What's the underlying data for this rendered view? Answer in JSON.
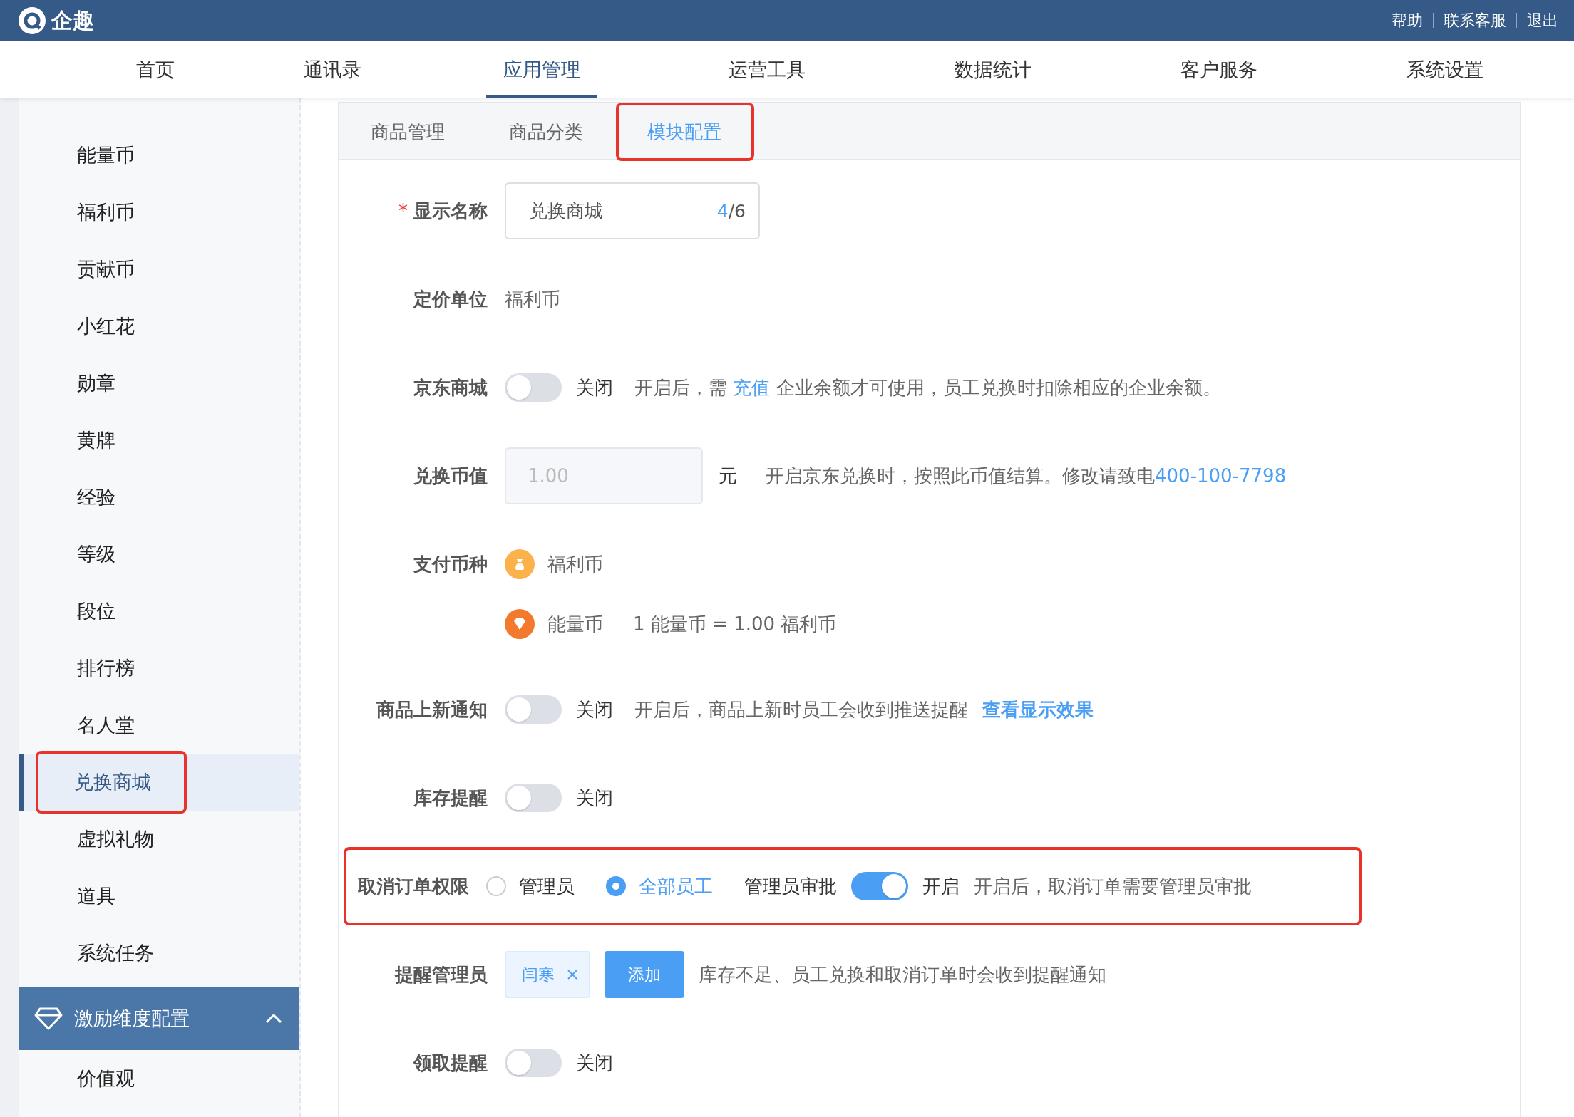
{
  "topbar": {
    "logo": "企趣",
    "links": [
      "帮助",
      "联系客服",
      "退出"
    ]
  },
  "nav": [
    {
      "label": "首页",
      "selected": false
    },
    {
      "label": "通讯录",
      "selected": false
    },
    {
      "label": "应用管理",
      "selected": true
    },
    {
      "label": "运营工具",
      "selected": false
    },
    {
      "label": "数据统计",
      "selected": false
    },
    {
      "label": "客户服务",
      "selected": false
    },
    {
      "label": "系统设置",
      "selected": false
    }
  ],
  "sidebar": {
    "items": [
      {
        "label": "能量币",
        "selected": false,
        "highlighted": false
      },
      {
        "label": "福利币",
        "selected": false,
        "highlighted": false
      },
      {
        "label": "贡献币",
        "selected": false,
        "highlighted": false
      },
      {
        "label": "小红花",
        "selected": false,
        "highlighted": false
      },
      {
        "label": "勋章",
        "selected": false,
        "highlighted": false
      },
      {
        "label": "黄牌",
        "selected": false,
        "highlighted": false
      },
      {
        "label": "经验",
        "selected": false,
        "highlighted": false
      },
      {
        "label": "等级",
        "selected": false,
        "highlighted": false
      },
      {
        "label": "段位",
        "selected": false,
        "highlighted": false
      },
      {
        "label": "排行榜",
        "selected": false,
        "highlighted": false
      },
      {
        "label": "名人堂",
        "selected": false,
        "highlighted": false
      },
      {
        "label": "兑换商城",
        "selected": true,
        "highlighted": true
      },
      {
        "label": "虚拟礼物",
        "selected": false,
        "highlighted": false
      },
      {
        "label": "道具",
        "selected": false,
        "highlighted": false
      },
      {
        "label": "系统任务",
        "selected": false,
        "highlighted": false
      }
    ],
    "section": {
      "label": "激励维度配置",
      "expanded": true,
      "items": [
        "价值观"
      ]
    }
  },
  "tabs": [
    {
      "label": "商品管理",
      "selected": false,
      "highlighted": false
    },
    {
      "label": "商品分类",
      "selected": false,
      "highlighted": false
    },
    {
      "label": "模块配置",
      "selected": true,
      "highlighted": true
    }
  ],
  "form": [
    {
      "kind": "input",
      "label": "显示名称",
      "required_mark": "*",
      "value": "兑换商城",
      "count": "4",
      "limit": "/6"
    },
    {
      "kind": "text",
      "label": "定价单位",
      "value": "福利币"
    },
    {
      "kind": "switch",
      "label": "京东商城",
      "on": false,
      "state_text": "关闭",
      "hint": "开启后，需 ",
      "link": "充值",
      "hint_after": " 企业余额才可使用，员工兑换时扣除相应的企业余额。"
    },
    {
      "kind": "rate",
      "label": "兑换币值",
      "value": "1.00",
      "unit": "元",
      "hint": "开启京东兑换时，按照此币值结算。修改请致电",
      "link": "400-100-7798"
    },
    {
      "kind": "currencies",
      "label": "支付币种",
      "items": [
        {
          "name": "福利币"
        },
        {
          "name": "能量币",
          "rate": "1 能量币 = 1.00 福利币"
        }
      ]
    },
    {
      "kind": "switch",
      "label": "商品上新通知",
      "on": false,
      "state_text": "关闭",
      "hint": "开启后，商品上新时员工会收到推送提醒",
      "extra_link": "查看显示效果"
    },
    {
      "kind": "switch",
      "label": "库存提醒",
      "on": false,
      "state_text": "关闭"
    },
    {
      "kind": "permission",
      "label": "取消订单权限",
      "highlighted": true,
      "options": [
        {
          "label": "管理员",
          "selected": false
        },
        {
          "label": "全部员工",
          "selected": true
        }
      ],
      "approval_label": "管理员审批",
      "on": true,
      "state_text": "开启",
      "hint": "开启后，取消订单需要管理员审批"
    },
    {
      "kind": "admins",
      "label": "提醒管理员",
      "tags": [
        "闫寒"
      ],
      "button": "添加",
      "hint": "库存不足、员工兑换和取消订单时会收到提醒通知"
    },
    {
      "kind": "switch",
      "label": "领取提醒",
      "on": false,
      "state_text": "关闭"
    }
  ]
}
